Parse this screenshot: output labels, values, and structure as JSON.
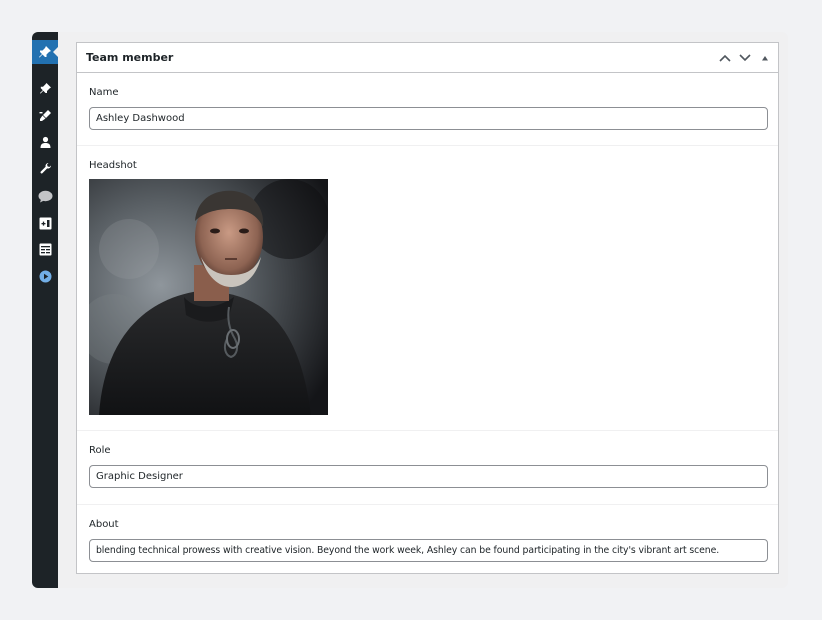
{
  "admin_menu": {
    "items": [
      {
        "name": "pin-icon",
        "active": true
      },
      {
        "name": "posts-icon",
        "active": false
      },
      {
        "name": "pencil-brush-icon",
        "active": false
      },
      {
        "name": "users-icon",
        "active": false
      },
      {
        "name": "wrench-icon",
        "active": false
      },
      {
        "name": "comment-bubble-icon",
        "active": false
      },
      {
        "name": "add-block-icon",
        "active": false
      },
      {
        "name": "table-icon",
        "active": false
      },
      {
        "name": "play-circle-icon",
        "active": false
      }
    ]
  },
  "postbox": {
    "title": "Team member",
    "actions": [
      "move-up-icon",
      "move-down-icon",
      "toggle-panel-icon"
    ]
  },
  "fields": {
    "name": {
      "label": "Name",
      "value": "Ashley Dashwood"
    },
    "headshot": {
      "label": "Headshot",
      "image": "portrait-photo"
    },
    "role": {
      "label": "Role",
      "value": "Graphic Designer"
    },
    "about": {
      "label": "About",
      "value": "blending technical prowess with creative vision. Beyond the work week, Ashley can be found participating in the city's vibrant art scene."
    }
  },
  "colors": {
    "admin_bar": "#1d2327",
    "admin_active": "#2271b1",
    "page_bg": "#f1f2f4",
    "input_border": "#8c8f94",
    "play_icon": "#72aee6"
  }
}
